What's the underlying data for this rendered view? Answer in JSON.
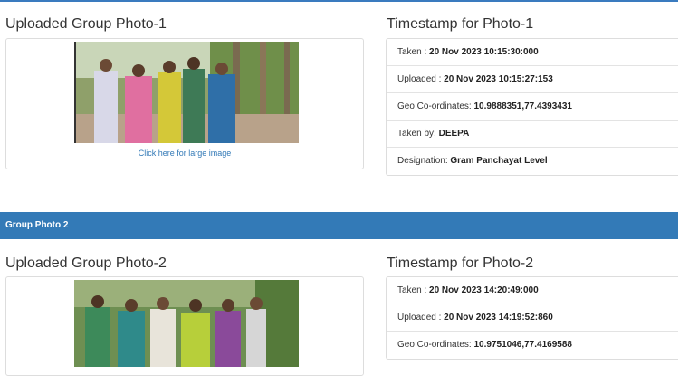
{
  "section1": {
    "title": "Uploaded Group Photo-1",
    "link_text": "Click here for large image",
    "timestamp_title": "Timestamp for Photo-1",
    "rows": [
      {
        "label": "Taken : ",
        "value": "20 Nov 2023 10:15:30:000"
      },
      {
        "label": "Uploaded : ",
        "value": "20 Nov 2023 10:15:27:153"
      },
      {
        "label": "Geo Co-ordinates: ",
        "value": "10.9888351,77.4393431"
      },
      {
        "label": "Taken by: ",
        "value": "DEEPA"
      },
      {
        "label": "Designation: ",
        "value": "Gram Panchayat Level"
      }
    ]
  },
  "panel2": {
    "header": "Group Photo 2"
  },
  "section2": {
    "title": "Uploaded Group Photo-2",
    "timestamp_title": "Timestamp for Photo-2",
    "rows": [
      {
        "label": "Taken : ",
        "value": "20 Nov 2023 14:20:49:000"
      },
      {
        "label": "Uploaded : ",
        "value": "20 Nov 2023 14:19:52:860"
      },
      {
        "label": "Geo Co-ordinates: ",
        "value": "10.9751046,77.4169588"
      }
    ]
  }
}
